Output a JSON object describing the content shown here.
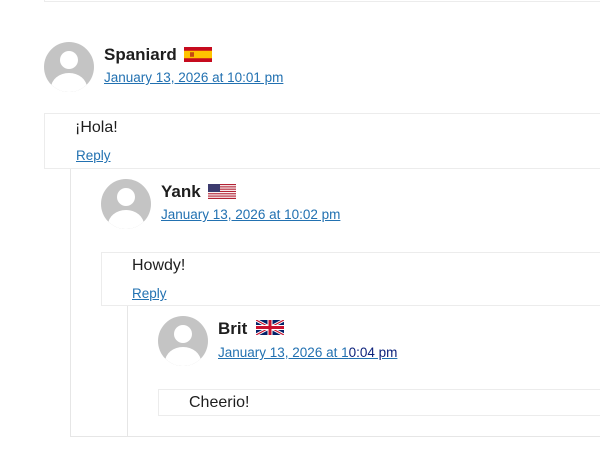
{
  "comments": [
    {
      "author": "Spaniard",
      "flag_icon": "spain-flag-icon",
      "date": "January 13, 2026 at 10:01 pm",
      "text": "¡Hola!",
      "reply_label": "Reply"
    },
    {
      "author": "Yank",
      "flag_icon": "us-flag-icon",
      "date": "January 13, 2026 at 10:02 pm",
      "text": "Howdy!",
      "reply_label": "Reply"
    },
    {
      "author": "Brit",
      "flag_icon": "uk-flag-icon",
      "date_part1": "January 13, 2026 at 1",
      "date_part2": "0:04 pm",
      "text": "Cheerio!"
    }
  ],
  "colors": {
    "link": "#2271b1",
    "link_visited": "#0a1f7a",
    "border": "#ececec",
    "text": "#1e1e1e"
  }
}
